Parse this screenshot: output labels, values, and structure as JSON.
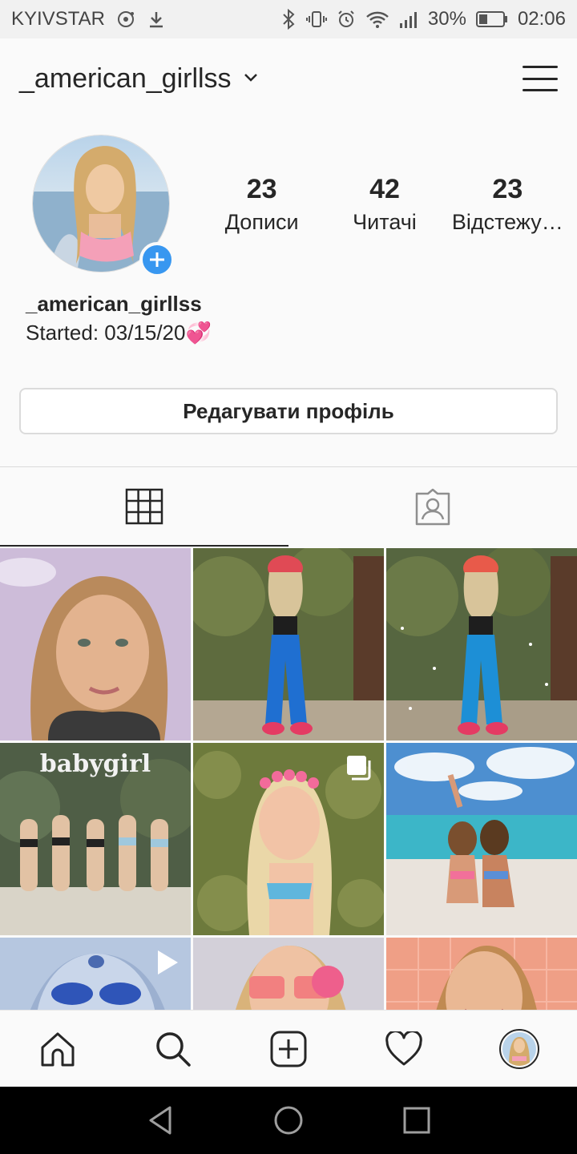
{
  "statusbar": {
    "carrier": "KYIVSTAR",
    "battery": "30%",
    "time": "02:06"
  },
  "header": {
    "username": "_american_girllss"
  },
  "profile": {
    "stats": [
      {
        "value": "23",
        "label": "Дописи"
      },
      {
        "value": "42",
        "label": "Читачі"
      },
      {
        "value": "23",
        "label": "Відстежу…"
      }
    ],
    "name": "_american_girllss",
    "bio": "Started: 03/15/20💞",
    "edit_button": "Редагувати профіль"
  },
  "grid": {
    "photo_overlay_text": "babygirl"
  },
  "colors": {
    "accent": "#3897f0",
    "text": "#262626",
    "border": "#dbdbdb"
  }
}
